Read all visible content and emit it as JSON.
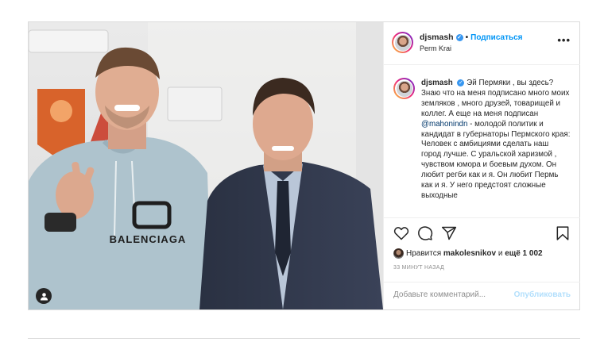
{
  "header": {
    "username": "djsmash",
    "verified_mark": "✓",
    "separator": "•",
    "follow_label": "Подписаться",
    "location": "Perm Krai",
    "more_label": "•••"
  },
  "caption": {
    "username": "djsmash",
    "text_before_mention": " Эй Пермяки , вы здесь? Знаю что на меня подписано много моих земляков , много друзей, товарищей и коллег. А еще на меня подписан ",
    "mention": "@mahonindn",
    "text_after_mention": " - молодой политик и кандидат в губернаторы Пермского края: Человек с амбициями сделать наш город лучше. С уральской харизмой , чувством юмора и боевым духом. Он любит регби как и я. Он любит Пермь как и я. У него предстоят сложные выходные"
  },
  "photo": {
    "hoodie_text": "BALENCIAGA",
    "tag_icon": "user-tag-icon"
  },
  "actions": {
    "icons": [
      "heart-icon",
      "comment-icon",
      "share-icon",
      "bookmark-icon"
    ]
  },
  "likes": {
    "prefix": "Нравится ",
    "user": "makolesnikov",
    "middle": " и ",
    "count_text": "ещё 1 002"
  },
  "time_text": "33 МИНУТ НАЗАД",
  "comment": {
    "placeholder": "Добавьте комментарий...",
    "publish_label": "Опубликовать"
  },
  "colors": {
    "accent": "#0095f6",
    "publish_disabled": "#b2dffc",
    "border": "#dbdbdb"
  }
}
